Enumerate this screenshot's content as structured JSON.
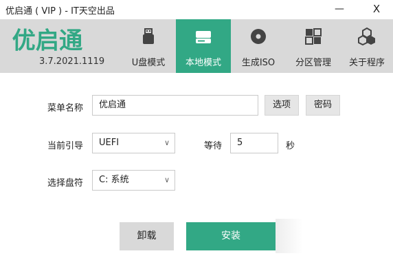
{
  "window": {
    "title": "优启通 ( VIP ) - IT天空出品",
    "minimize_label": "—",
    "close_label": "X"
  },
  "header": {
    "logo_text": "优启通",
    "version": "3.7.2021.1119",
    "brand_color": "#32a885",
    "nav": [
      {
        "label": "U盘模式",
        "icon": "usb-drive-icon",
        "active": false
      },
      {
        "label": "本地模式",
        "icon": "hard-disk-icon",
        "active": true
      },
      {
        "label": "生成ISO",
        "icon": "disc-icon",
        "active": false
      },
      {
        "label": "分区管理",
        "icon": "partition-grid-icon",
        "active": false
      },
      {
        "label": "关于程序",
        "icon": "cubes-icon",
        "active": false
      }
    ]
  },
  "form": {
    "menu_name_label": "菜单名称",
    "menu_name_value": "优启通",
    "options_button": "选项",
    "password_button": "密码",
    "boot_label": "当前引导",
    "boot_value": "UEFI",
    "wait_label": "等待",
    "wait_value": "5",
    "wait_unit": "秒",
    "disk_label": "选择盘符",
    "disk_value": "C: 系统"
  },
  "actions": {
    "uninstall": "卸载",
    "install": "安装"
  }
}
